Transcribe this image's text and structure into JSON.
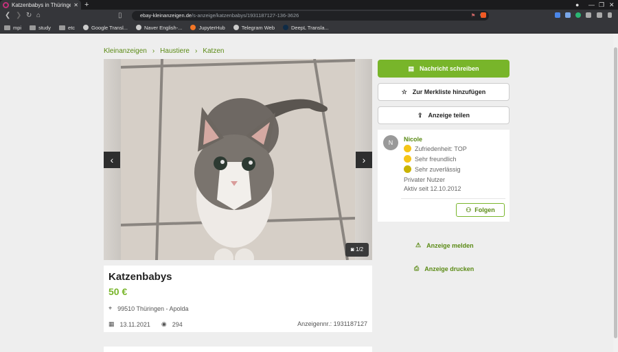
{
  "browser": {
    "tab_title": "Katzenbabys in Thüringen",
    "url_domain": "ebay-kleinanzeigen.de",
    "url_path": "/s-anzeige/katzenbabys/1931187127-136-3626",
    "bookmarks": [
      {
        "label": "mpi",
        "icon": "folder-icon"
      },
      {
        "label": "study",
        "icon": "folder-icon"
      },
      {
        "label": "etc",
        "icon": "folder-icon"
      },
      {
        "label": "Google Transl...",
        "icon": "globe-icon"
      },
      {
        "label": "Naver English-...",
        "icon": "globe-icon"
      },
      {
        "label": "JupyterHub",
        "icon": "jupyter-icon"
      },
      {
        "label": "Telegram Web",
        "icon": "globe-icon"
      },
      {
        "label": "DeepL Transla...",
        "icon": "deepl-icon"
      }
    ]
  },
  "breadcrumb": [
    "Kleinanzeigen",
    "Haustiere",
    "Katzen"
  ],
  "gallery": {
    "counter": "1/2"
  },
  "ad": {
    "title": "Katzenbabys",
    "price": "50 €",
    "location": "99510 Thüringen - Apolda",
    "date": "13.11.2021",
    "views": "294",
    "ad_number": "Anzeigennr.: 1931187127"
  },
  "actions": {
    "message": "Nachricht schreiben",
    "watchlist": "Zur Merkliste hinzufügen",
    "share": "Anzeige teilen",
    "report": "Anzeige melden",
    "print": "Anzeige drucken"
  },
  "seller": {
    "initial": "N",
    "name": "Nicole",
    "satisfaction": "Zufriedenheit: TOP",
    "friendly": "Sehr freundlich",
    "reliable": "Sehr zuverlässig",
    "type": "Privater Nutzer",
    "active_since": "Aktiv seit 12.10.2012",
    "follow": "Folgen"
  },
  "colors": {
    "accent": "#78b52a",
    "link": "#5a8a14"
  }
}
